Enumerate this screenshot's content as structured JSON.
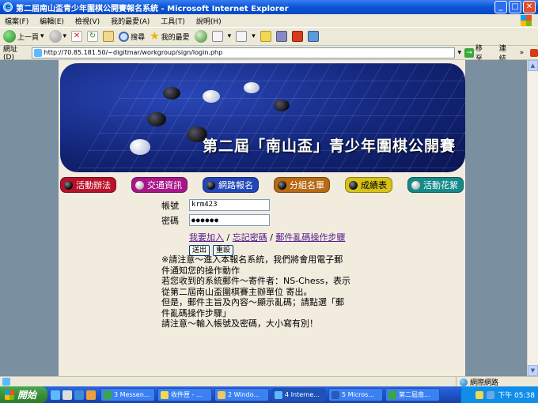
{
  "window": {
    "title": "第二屆南山盃青少年圍棋公開賽報名系統 - Microsoft Internet Explorer"
  },
  "menu": [
    "檔案(F)",
    "編輯(E)",
    "檢視(V)",
    "我的最愛(A)",
    "工具(T)",
    "說明(H)"
  ],
  "toolbar": {
    "back": "上一頁",
    "search": "搜尋",
    "favorites": "我的最愛"
  },
  "address": {
    "label": "網址(D)",
    "url": "http://70.85.181.50/~digitmar/workgroup/sign/login.php",
    "go": "移至",
    "links": "連結"
  },
  "banner": {
    "title": "第二屆「南山盃」青少年圍棋公開賽"
  },
  "nav": [
    {
      "label": "活動辦法",
      "color": "#b8122a",
      "dot": "black"
    },
    {
      "label": "交通資訊",
      "color": "#a8168a",
      "dot": "white"
    },
    {
      "label": "網路報名",
      "color": "#2246b8",
      "dot": "black"
    },
    {
      "label": "分組名單",
      "color": "#b86a14",
      "dot": "black"
    },
    {
      "label": "成績表",
      "color": "#d8c21a",
      "dot": "black"
    },
    {
      "label": "活動花絮",
      "color": "#168a8a",
      "dot": "white"
    }
  ],
  "form": {
    "account_label": "帳號",
    "account_value": "krm423",
    "password_label": "密碼",
    "password_value": "●●●●●●",
    "link_join": "我要加入",
    "link_forgot": "忘記密碼",
    "link_mail": "郵件亂碼操作步驟",
    "sep": " / ",
    "submit": "送出",
    "reset": "重設"
  },
  "notes": [
    "※請注意～進入本報名系統，我們將會用電子郵件通知您的操作動作",
    "若您收到的系統郵件～寄件者：NS-Chess，表示從第二屆南山盃圍棋賽主辦單位 寄出。",
    "但是，郵件主旨及內容～顯示亂碼；請點選「郵件亂碼操作步驟」",
    "請注意～輸入帳號及密碼，大小寫有別！"
  ],
  "status": {
    "zone": "網際網路"
  },
  "taskbar": {
    "start": "開始",
    "tasks": [
      "3 Messen...",
      "收件匣 - ...",
      "2 Windo...",
      "4 Interne...",
      "5 Micros...",
      "第二屆南..."
    ],
    "clock": "下午 05:38"
  }
}
